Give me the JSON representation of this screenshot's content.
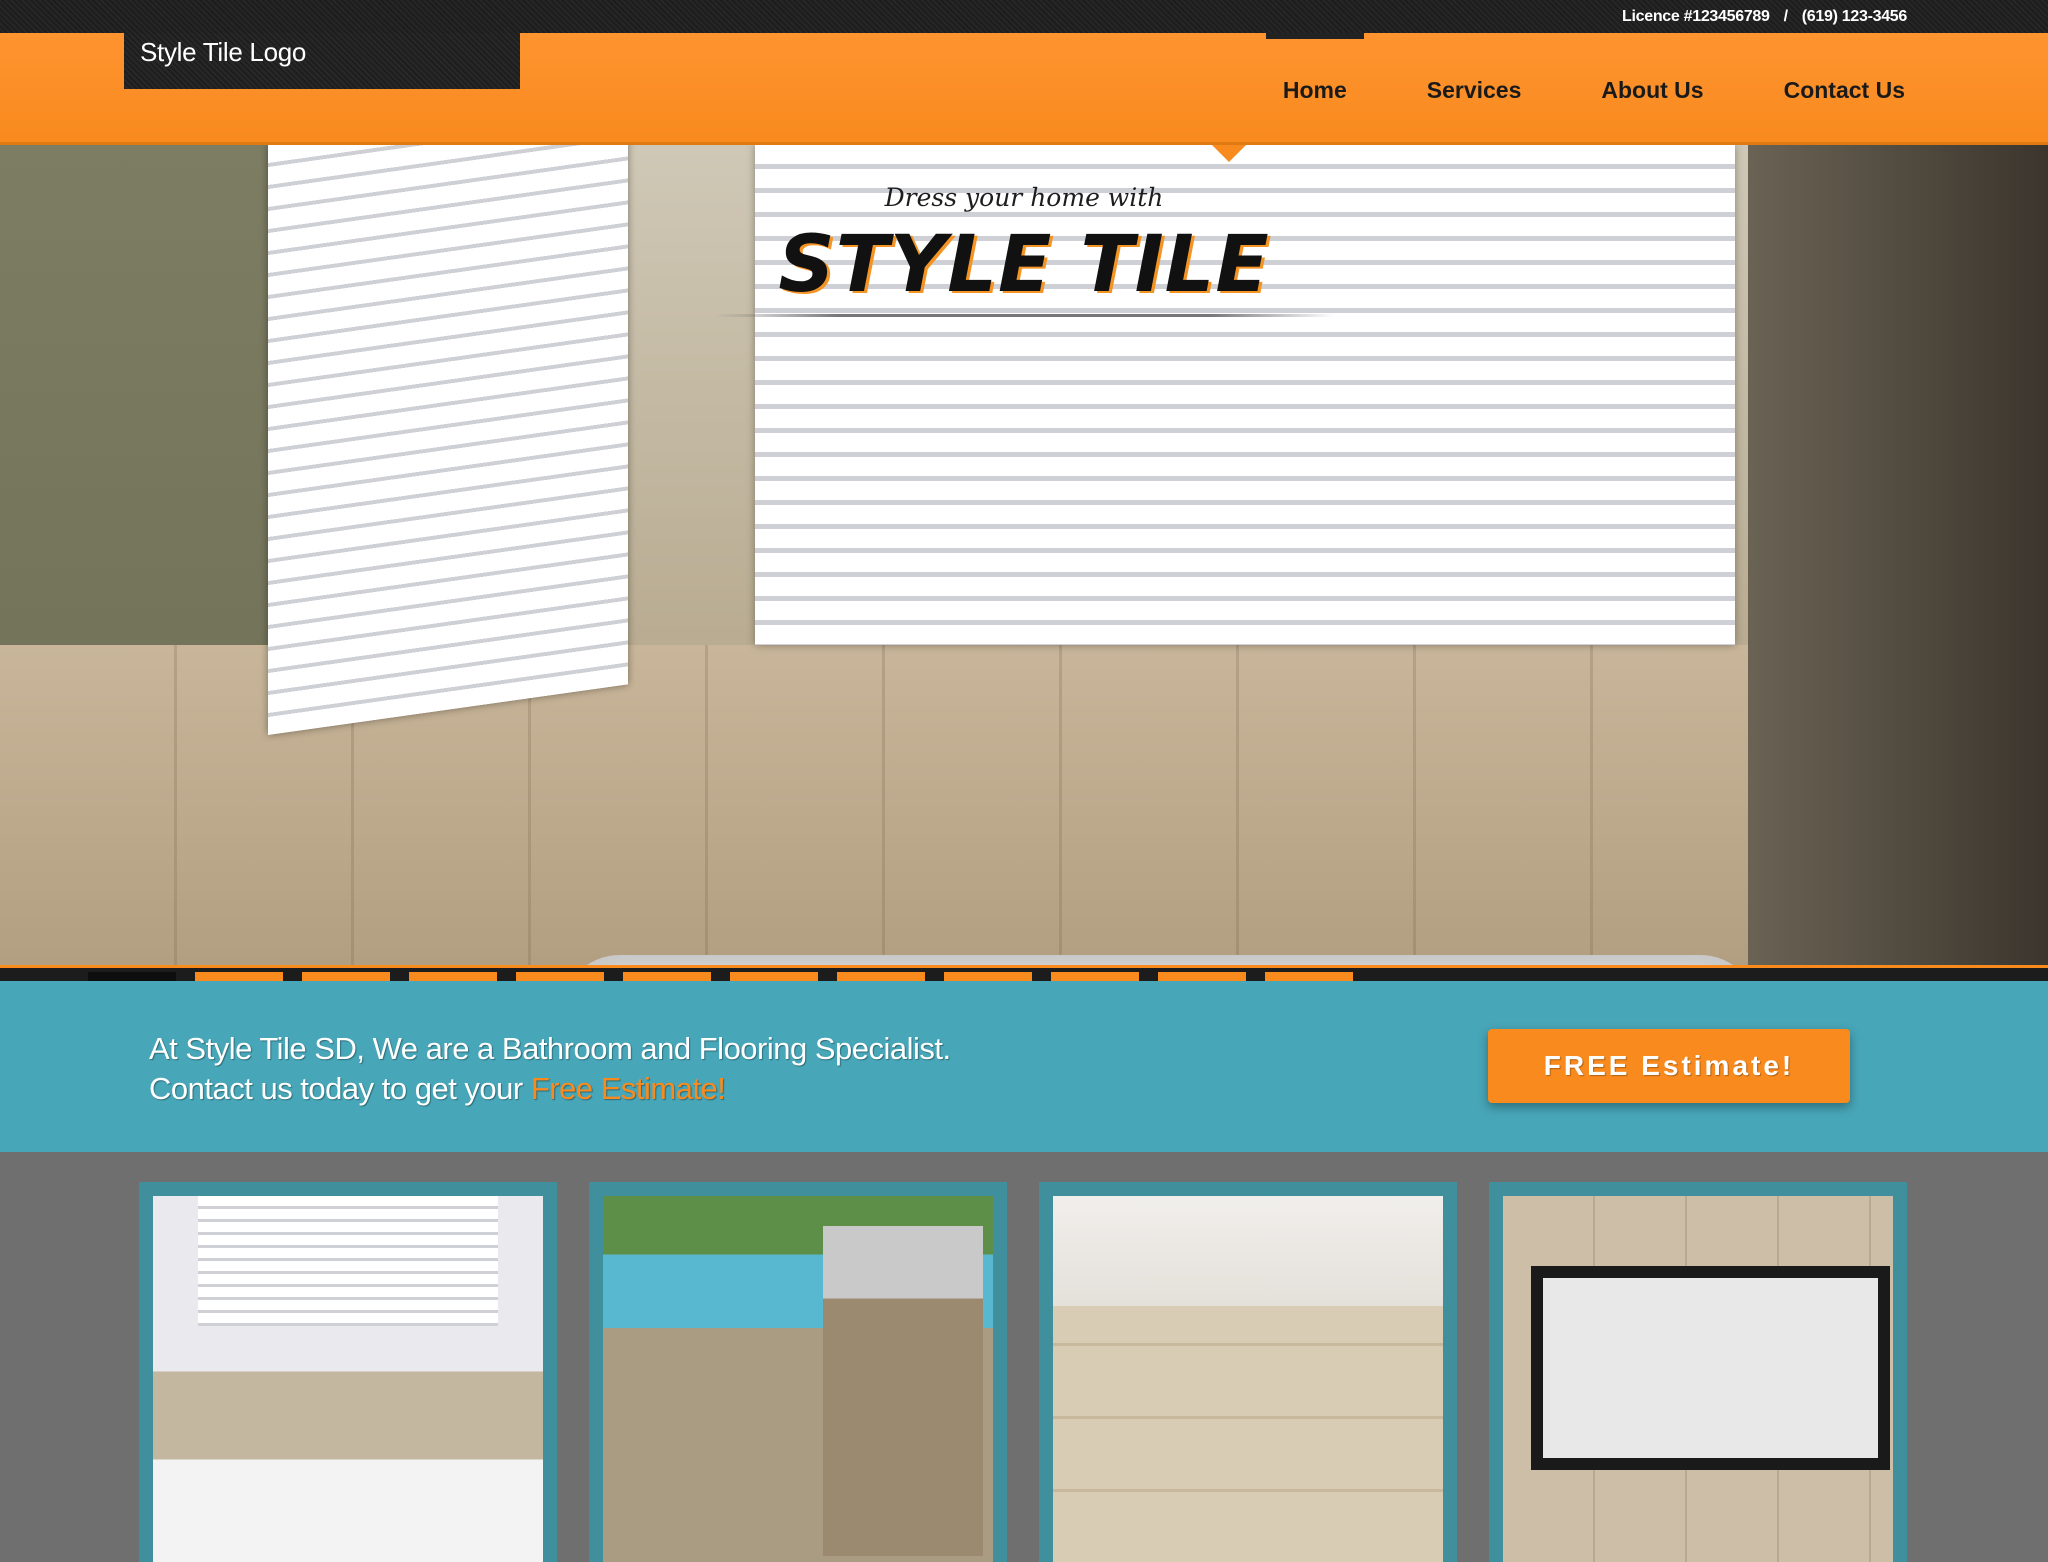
{
  "topbar": {
    "licence": "Licence #123456789",
    "separator": "/",
    "phone": "(619) 123-3456"
  },
  "header": {
    "logo": "Style Tile Logo",
    "nav": [
      {
        "label": "Home",
        "active": true
      },
      {
        "label": "Services",
        "active": false
      },
      {
        "label": "About Us",
        "active": false
      },
      {
        "label": "Contact Us",
        "active": false
      }
    ]
  },
  "hero": {
    "small_text": "Dress your home with",
    "big_text": "STYLE TILE",
    "slide_count": 12,
    "active_slide": 1
  },
  "banner": {
    "line1": "At Style Tile SD, We are a Bathroom and Flooring Specialist.",
    "line2_prefix": "Contact us today to get your ",
    "line2_highlight": "Free Estimate!",
    "button": "FREE Estimate!"
  },
  "gallery": [
    "bathroom-thumbnail",
    "outdoor-kitchen-thumbnail",
    "tile-floor-thumbnail",
    "fireplace-thumbnail"
  ],
  "colors": {
    "accent_orange": "#f88a1e",
    "teal": "#47a6b8",
    "dark": "#1d1d1d",
    "gallery_bg": "#6f6f6f"
  }
}
